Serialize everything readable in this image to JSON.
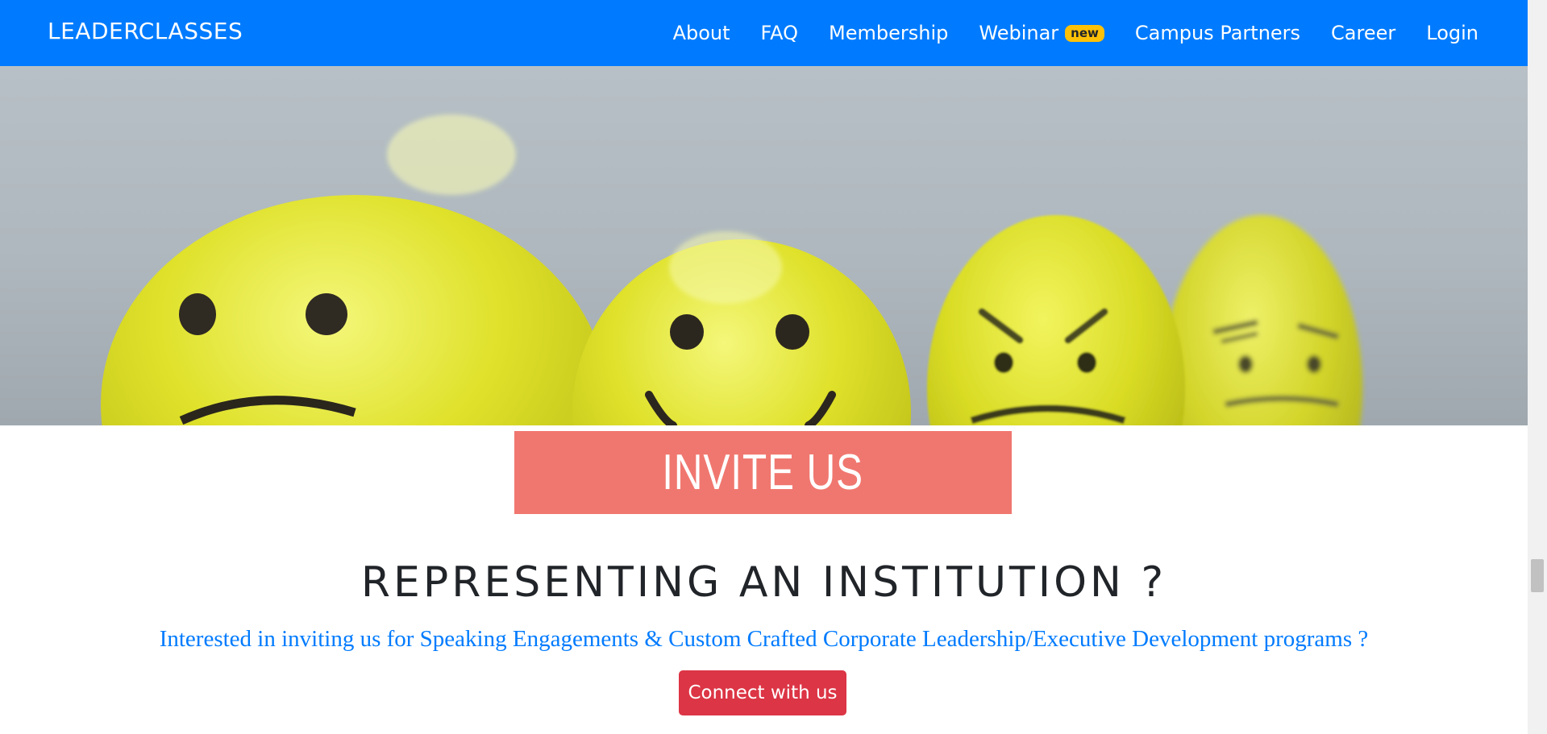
{
  "navbar": {
    "brand": "LEADERCLASSES",
    "links": [
      {
        "label": "About"
      },
      {
        "label": "FAQ"
      },
      {
        "label": "Membership"
      },
      {
        "label": "Webinar",
        "badge": "new"
      },
      {
        "label": "Campus Partners"
      },
      {
        "label": "Career"
      },
      {
        "label": "Login"
      }
    ]
  },
  "hero": {
    "image": "yellow-emoji-balls-photo"
  },
  "invite": {
    "banner": "INVITE US",
    "headline": "REPRESENTING AN INSTITUTION ?",
    "subtext": "Interested in inviting us for Speaking Engagements & Custom Crafted Corporate Leadership/Executive Development programs ?",
    "button": "Connect with us"
  },
  "colors": {
    "navbar": "#007bff",
    "badge": "#ffc107",
    "invite_box": "#f0776f",
    "subtext": "#007bff",
    "button": "#dc3545"
  }
}
